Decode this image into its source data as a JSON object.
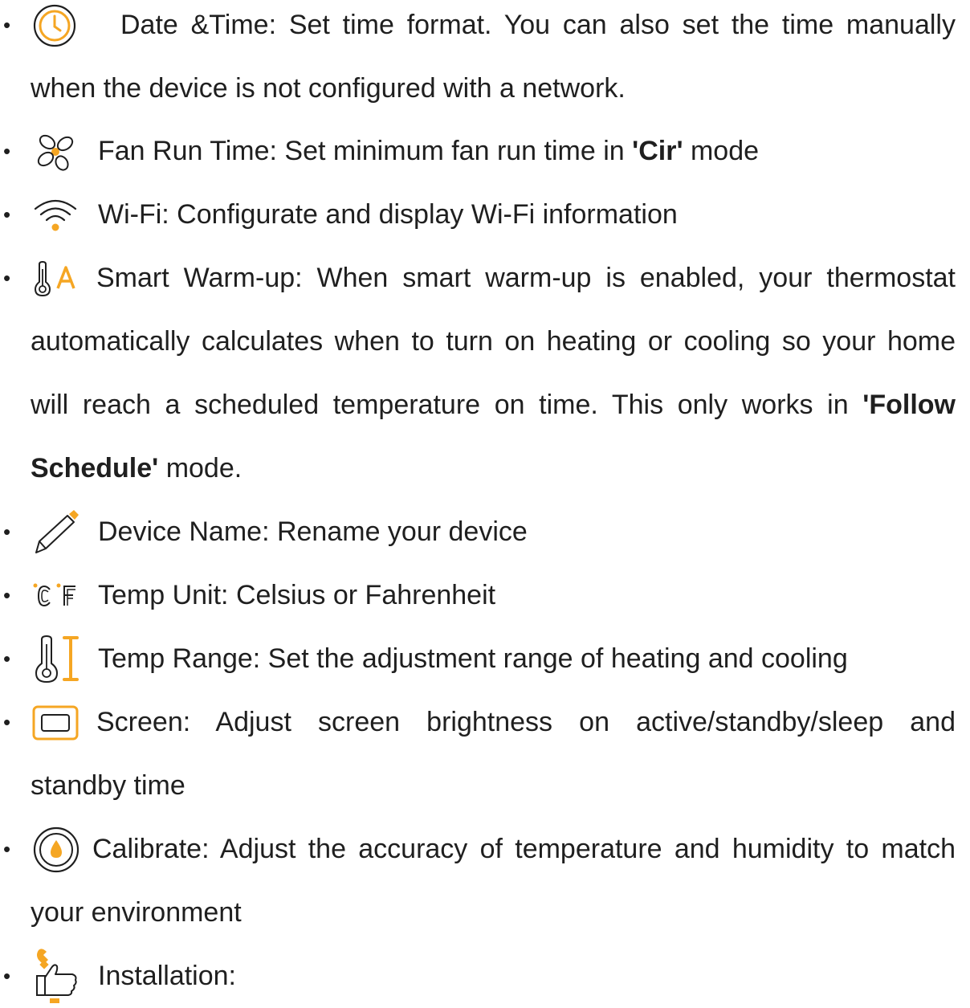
{
  "accent_color": "#F5A623",
  "items": [
    {
      "icon": "clock-icon",
      "lines": [
        "Date &Time: Set time format. You can also set the time manually",
        "when the device is not configured with a network."
      ]
    },
    {
      "icon": "fan-icon",
      "pre": "Fan Run Time: Set minimum fan run time in ",
      "bold": "'Cir'",
      "post": " mode"
    },
    {
      "icon": "wifi-icon",
      "lines": [
        "Wi-Fi: Configurate and display Wi-Fi information"
      ]
    },
    {
      "icon": "smart-warmup-icon",
      "lines": [
        "Smart Warm-up: When smart warm-up is enabled, your thermostat",
        "automatically calculates when to turn on heating or cooling so your home"
      ],
      "line3_pre": "will reach a scheduled temperature on time. This only works in ",
      "line3_bold": "'Follow",
      "line4_bold": "Schedule'",
      "line4_post": " mode."
    },
    {
      "icon": "pencil-icon",
      "lines": [
        "Device Name: Rename your device"
      ]
    },
    {
      "icon": "temp-unit-icon",
      "lines": [
        "Temp Unit: Celsius or Fahrenheit"
      ]
    },
    {
      "icon": "temp-range-icon",
      "lines": [
        "Temp Range: Set the adjustment range of heating and cooling"
      ]
    },
    {
      "icon": "screen-icon",
      "lines": [
        "Screen: Adjust screen brightness on active/standby/sleep and",
        "standby time"
      ]
    },
    {
      "icon": "calibrate-icon",
      "lines": [
        "Calibrate: Adjust the accuracy of temperature and humidity to match",
        "your environment"
      ]
    },
    {
      "icon": "installation-icon",
      "lines": [
        "Installation:"
      ]
    }
  ],
  "bullet_char": "•"
}
